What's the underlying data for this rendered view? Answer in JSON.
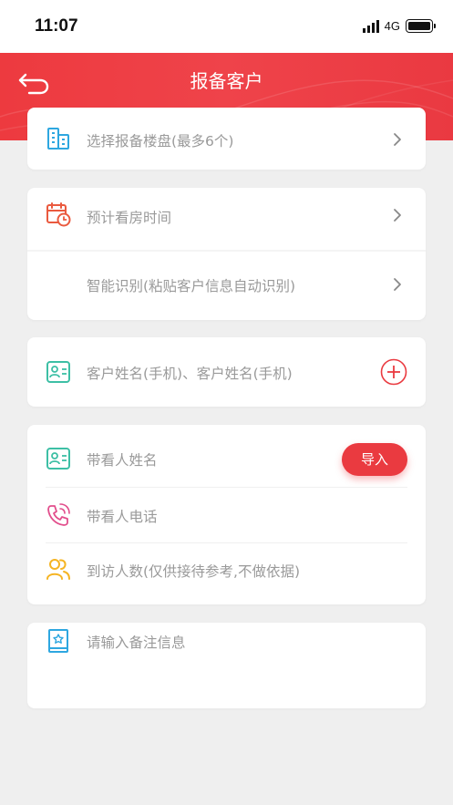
{
  "status_bar": {
    "time": "11:07",
    "network": "4G"
  },
  "header": {
    "title": "报备客户"
  },
  "project_card": {
    "label": "选择报备楼盘(最多6个)"
  },
  "visit_card": {
    "visit_time_label": "预计看房时间",
    "smart_recognize_label": "智能识别(粘贴客户信息自动识别)"
  },
  "customer_card": {
    "label": "客户姓名(手机)、客户姓名(手机)"
  },
  "companion_card": {
    "name_label": "带看人姓名",
    "import_label": "导入",
    "phone_label": "带看人电话",
    "visitors_label": "到访人数(仅供接待参考,不做依据)"
  },
  "remarks_card": {
    "placeholder": "请输入备注信息"
  },
  "colors": {
    "brand_red": "#ea3a40",
    "icon_blue": "#2ea7e0",
    "icon_teal": "#3dbfa5",
    "icon_pink": "#e24e8c",
    "icon_yellow": "#f5b423"
  },
  "icons": {
    "back": "back-arrow-icon",
    "building": "building-icon",
    "calendar": "calendar-clock-icon",
    "contact": "contact-card-icon",
    "phone": "phone-ringing-icon",
    "people": "people-icon",
    "notes": "notebook-icon",
    "add": "add-circle-icon",
    "chevron": "chevron-right-icon"
  }
}
